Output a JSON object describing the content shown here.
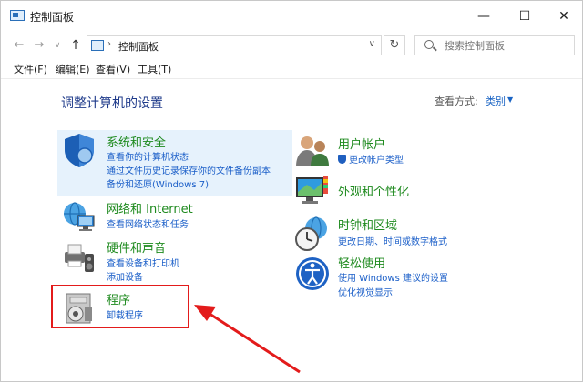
{
  "window": {
    "title": "控制面板",
    "minimize_glyph": "—",
    "maximize_glyph": "☐",
    "close_glyph": "✕"
  },
  "nav": {
    "back_glyph": "←",
    "forward_glyph": "→",
    "recent_glyph": "∨",
    "up_glyph": "↑",
    "address_separator": "›",
    "address_text": "控制面板",
    "address_dropdown_glyph": "∨",
    "refresh_glyph": "↻",
    "search_placeholder": "搜索控制面板"
  },
  "menu": {
    "file": "文件(F)",
    "edit": "编辑(E)",
    "view": "查看(V)",
    "tools": "工具(T)"
  },
  "content": {
    "title": "调整计算机的设置",
    "view_by_label": "查看方式:",
    "view_by_value": "类别",
    "view_by_arrow": "▼"
  },
  "categories": {
    "system": {
      "title": "系统和安全",
      "links": [
        "查看你的计算机状态",
        "通过文件历史记录保存你的文件备份副本",
        "备份和还原(Windows 7)"
      ]
    },
    "network": {
      "title": "网络和 Internet",
      "links": [
        "查看网络状态和任务"
      ]
    },
    "hardware": {
      "title": "硬件和声音",
      "links": [
        "查看设备和打印机",
        "添加设备"
      ]
    },
    "programs": {
      "title": "程序",
      "links": [
        "卸载程序"
      ]
    },
    "users": {
      "title": "用户帐户",
      "links": [
        "更改帐户类型"
      ]
    },
    "appearance": {
      "title": "外观和个性化",
      "links": []
    },
    "clock": {
      "title": "时钟和区域",
      "links": [
        "更改日期、时间或数字格式"
      ]
    },
    "ease": {
      "title": "轻松使用",
      "links": [
        "使用 Windows 建议的设置",
        "优化视觉显示"
      ]
    }
  },
  "colors": {
    "category_title": "#1e8a1e",
    "link": "#1a5ec8",
    "highlight": "#e6f2fc",
    "annotation_red": "#e31b1b"
  }
}
